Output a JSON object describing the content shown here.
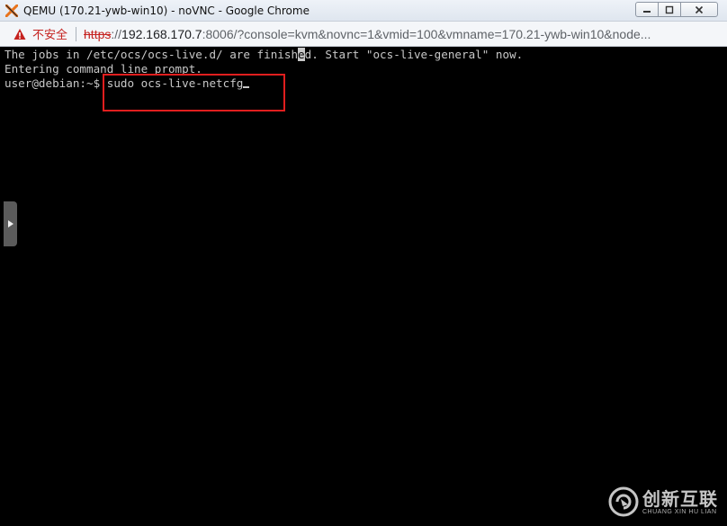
{
  "window": {
    "title": "QEMU (170.21-ywb-win10) - noVNC - Google Chrome",
    "controls": {
      "minimize": "▭",
      "maximize": "▢",
      "close": "✕"
    }
  },
  "addressbar": {
    "security_label": "不安全",
    "url_scheme": "https",
    "url_sep": "://",
    "url_host": "192.168.170.7",
    "url_rest": ":8006/?console=kvm&novnc=1&vmid=100&vmname=170.21-ywb-win10&node..."
  },
  "terminal": {
    "line1_before_cursor": "The jobs in /etc/ocs/ocs-live.d/ are finish",
    "line1_cursor_char": "e",
    "line1_after_cursor": "d. Start \"ocs-live-general\" now.",
    "line2": "Entering command line prompt.",
    "prompt": "user@debian:~$ ",
    "command": "sudo ocs-live-netcfg",
    "colors": {
      "foreground": "#c8c8c8",
      "background": "#000000",
      "highlight_box": "#e01e1e"
    }
  },
  "watermark": {
    "name_cn": "创新互联",
    "name_en": "CHUANG XIN HU LIAN"
  },
  "icons": {
    "app": "qemu-logo-icon",
    "warning": "warning-triangle-icon",
    "handle": "expand-arrow-icon"
  }
}
